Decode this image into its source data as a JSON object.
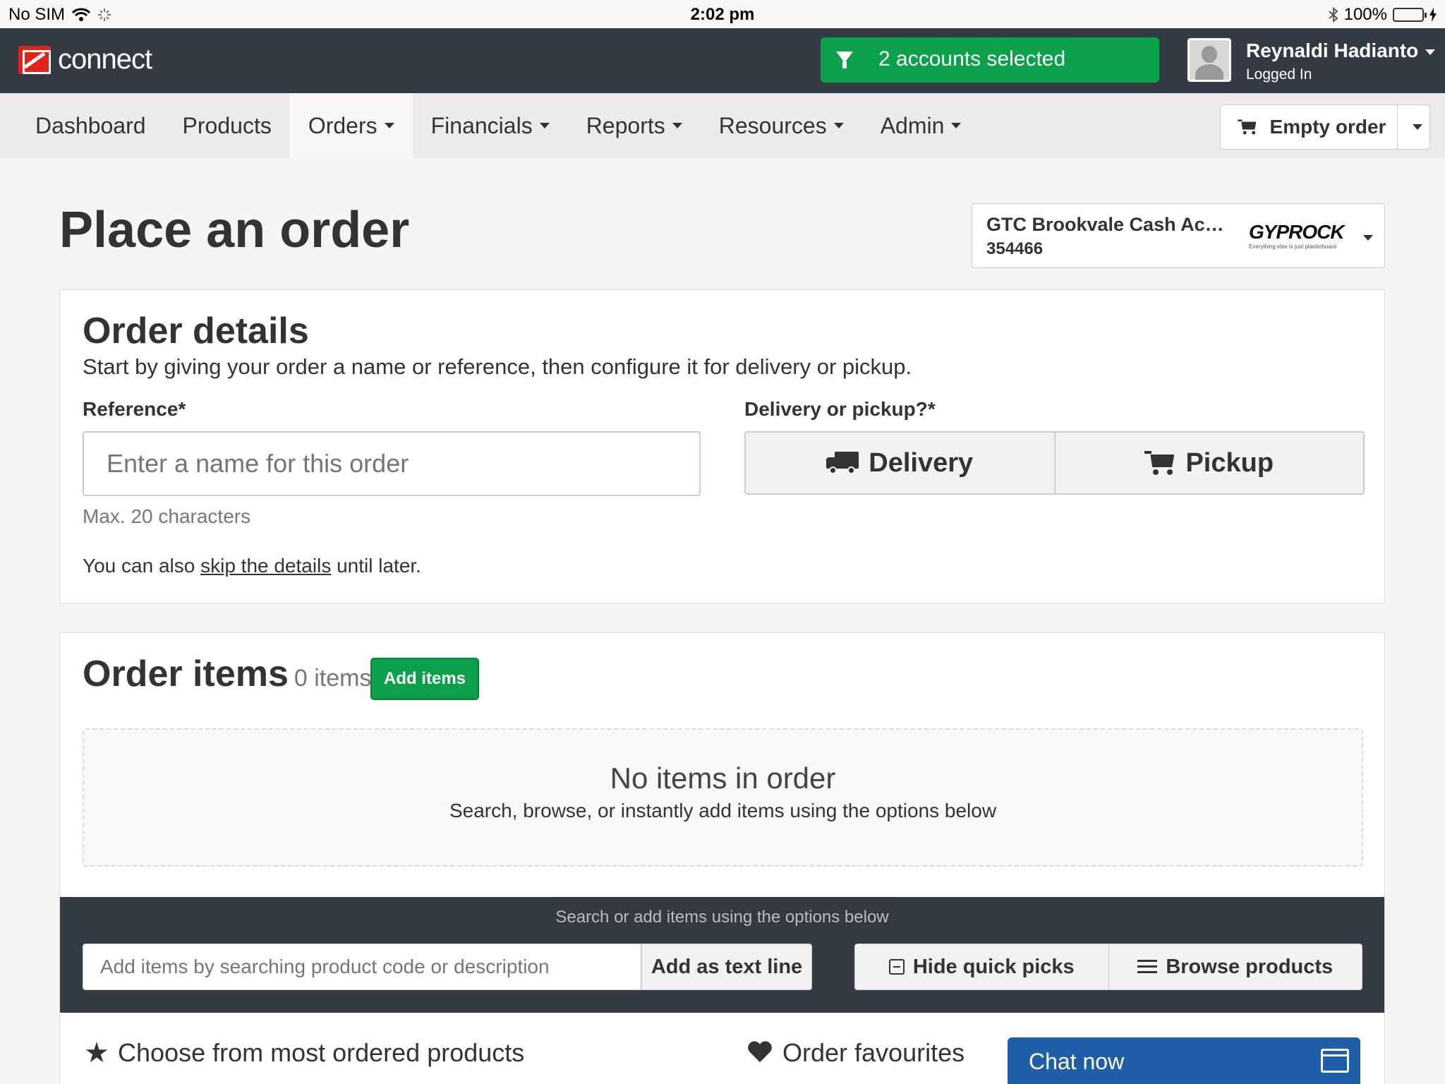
{
  "status_bar": {
    "carrier": "No SIM",
    "time": "2:02 pm",
    "battery": "100%"
  },
  "header": {
    "logo_text": "connect",
    "account_filter": "2 accounts selected",
    "user_name": "Reynaldi Hadianto",
    "user_status": "Logged In"
  },
  "nav": {
    "items": [
      {
        "label": "Dashboard"
      },
      {
        "label": "Products"
      },
      {
        "label": "Orders"
      },
      {
        "label": "Financials"
      },
      {
        "label": "Reports"
      },
      {
        "label": "Resources"
      },
      {
        "label": "Admin"
      }
    ],
    "active": "Orders",
    "order_button": "Empty order"
  },
  "page": {
    "title": "Place an order",
    "account": {
      "name": "GTC Brookvale Cash Acc...",
      "number": "354466",
      "brand": "GYPROCK",
      "brand_tagline": "Everything else is just plasterboard"
    }
  },
  "order_details": {
    "heading": "Order details",
    "description": "Start by giving your order a name or reference, then configure it for delivery or pickup.",
    "reference_label": "Reference*",
    "reference_placeholder": "Enter a name for this order",
    "reference_help": "Max. 20 characters",
    "skip_prefix": "You can also ",
    "skip_link": "skip the details",
    "skip_suffix": " until later.",
    "delivery_label": "Delivery or pickup?*",
    "delivery_option": "Delivery",
    "pickup_option": "Pickup"
  },
  "order_items": {
    "heading": "Order items",
    "count": "0 items",
    "add_button": "Add items",
    "empty_title": "No items in order",
    "empty_subtitle": "Search, browse, or instantly add items using the options below",
    "search_caption": "Search or add items using the options below",
    "search_placeholder": "Add items by searching product code or description",
    "add_text_line": "Add as text line",
    "hide_quick_picks": "Hide quick picks",
    "browse_products": "Browse products",
    "most_ordered": "Choose from most ordered products",
    "favourites": "Order favourites"
  },
  "chat": {
    "label": "Chat now"
  },
  "colors": {
    "accent_green": "#0aa14a",
    "header_dark": "#343a44",
    "chat_blue": "#1f5ea8"
  }
}
